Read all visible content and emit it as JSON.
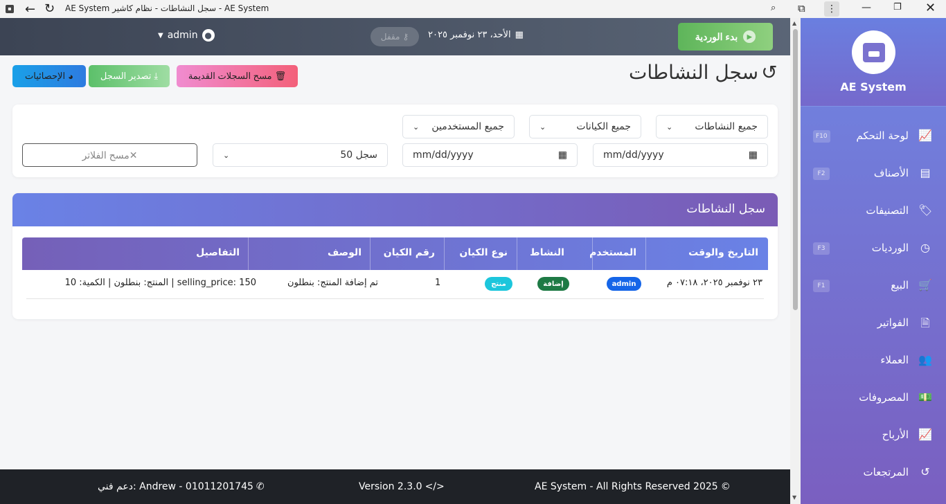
{
  "window": {
    "title": "AE System سجل النشاطات - نظام كاشير - AE System"
  },
  "topbar": {
    "shift_button": "بدء الوردية",
    "date": "الأحد، ٢٣ نوفمبر ٢٠٢٥",
    "lock_label": "مقفل",
    "user_name": "admin"
  },
  "page": {
    "title": "سجل النشاطات",
    "clear_old_label": "مسح السجلات القديمة",
    "export_label": "تصدير السجل",
    "stats_label": "الإحصائيات"
  },
  "filters": {
    "activities": "جميع النشاطات",
    "entities": "جميع الكيانات",
    "users": "جميع المستخدمين",
    "date_from_placeholder": "mm/dd/yyyy",
    "date_to_placeholder": "mm/dd/yyyy",
    "page_size": "50 سجل",
    "clear_filters": "مسح الفلاتر"
  },
  "table": {
    "card_title": "سجل النشاطات",
    "columns": [
      "التاريخ والوقت",
      "المستخدم",
      "النشاط",
      "نوع الكيان",
      "رقم الكيان",
      "الوصف",
      "التفاصيل"
    ],
    "rows": [
      {
        "datetime": "٢٣ نوفمبر ٢٠٢٥، ٠٧:١٨ م",
        "user": "admin",
        "activity": "إضافة",
        "entity_type": "منتج",
        "entity_id": "1",
        "description": "تم إضافة المنتج: بنطلون",
        "details": "المنتج: بنطلون | الكمية: 10 | selling_price: 150"
      }
    ]
  },
  "sidebar": {
    "brand": "AE System",
    "items": [
      {
        "label": "لوحة التحكم",
        "shortcut": "F10",
        "icon": "chart-line-icon"
      },
      {
        "label": "الأصناف",
        "shortcut": "F2",
        "icon": "box-icon"
      },
      {
        "label": "التصنيفات",
        "shortcut": "",
        "icon": "tags-icon"
      },
      {
        "label": "الورديات",
        "shortcut": "F3",
        "icon": "clock-icon"
      },
      {
        "label": "البيع",
        "shortcut": "F1",
        "icon": "cart-icon"
      },
      {
        "label": "الفواتير",
        "shortcut": "",
        "icon": "invoice-icon"
      },
      {
        "label": "العملاء",
        "shortcut": "",
        "icon": "users-icon"
      },
      {
        "label": "المصروفات",
        "shortcut": "",
        "icon": "money-icon"
      },
      {
        "label": "الأرباح",
        "shortcut": "",
        "icon": "chart-line-icon"
      },
      {
        "label": "المرتجعات",
        "shortcut": "",
        "icon": "undo-icon"
      }
    ]
  },
  "footer": {
    "copyright": "AE System - All Rights Reserved 2025",
    "version": "Version 2.3.0",
    "support": "دعم فني: Andrew - 01011201745"
  },
  "colors": {
    "sidebar_top": "#6f86e3",
    "sidebar_bottom": "#7a5fc0",
    "shift_green": "#5eb55a",
    "footer_bg": "#1f2227"
  }
}
